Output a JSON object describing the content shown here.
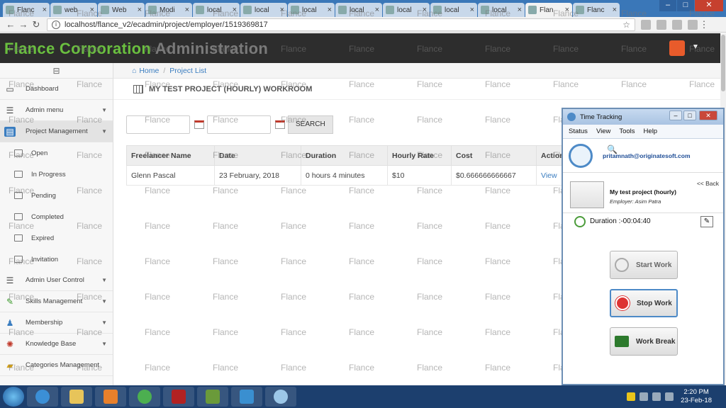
{
  "browser": {
    "tabs": [
      {
        "title": "Flanc"
      },
      {
        "title": "web"
      },
      {
        "title": "Web"
      },
      {
        "title": "Modi"
      },
      {
        "title": "local"
      },
      {
        "title": "local"
      },
      {
        "title": "local"
      },
      {
        "title": "local"
      },
      {
        "title": "local"
      },
      {
        "title": "local"
      },
      {
        "title": "local"
      },
      {
        "title": "Flan"
      },
      {
        "title": "Flanc"
      }
    ],
    "url": "localhost/flance_v2/ecadmin/project/employer/1519369817"
  },
  "header": {
    "brand_main": "Flance Corporation",
    "brand_sub": "Administration"
  },
  "sidebar": {
    "items": [
      {
        "label": "Dashboard"
      },
      {
        "label": "Admin menu"
      },
      {
        "label": "Project Management"
      },
      {
        "label": "Admin User Control"
      },
      {
        "label": "Skills Management"
      },
      {
        "label": "Membership"
      },
      {
        "label": "Knowledge Base"
      },
      {
        "label": "Categories Management"
      }
    ],
    "subitems": [
      {
        "label": "Open"
      },
      {
        "label": "In Progress"
      },
      {
        "label": "Pending"
      },
      {
        "label": "Completed"
      },
      {
        "label": "Expired"
      },
      {
        "label": "Invitation"
      }
    ]
  },
  "main": {
    "breadcrumb": {
      "home": "Home",
      "current": "Project List"
    },
    "page_title": "MY TEST PROJECT (HOURLY) WORKROOM",
    "search_label": "SEARCH",
    "table": {
      "headers": [
        "Freelancer Name",
        "Date",
        "Duration",
        "Hourly Rate",
        "Cost",
        "Action"
      ],
      "rows": [
        [
          "Glenn Pascal",
          "23 February, 2018",
          "0 hours 4 minutes",
          "$10",
          "$0.666666666667",
          "View"
        ]
      ]
    }
  },
  "watermark": "Flance",
  "time_tracking": {
    "title": "Time Tracking",
    "menu": [
      "Status",
      "View",
      "Tools",
      "Help"
    ],
    "email": "pritamnath@originatesoft.com",
    "back": "<< Back",
    "project": "My test project (hourly)",
    "employer": "Employer: Asim Patra",
    "duration": "Duration :-00:04:40",
    "start": "Start Work",
    "stop": "Stop Work",
    "break": "Work Break"
  },
  "taskbar": {
    "time": "2:20 PM",
    "date": "23-Feb-18"
  },
  "colors": {
    "brand_green": "#6abf3f",
    "header_bg": "#2d2d2d",
    "link_blue": "#3a7dc0",
    "taskbar": "#1c3f6e"
  }
}
